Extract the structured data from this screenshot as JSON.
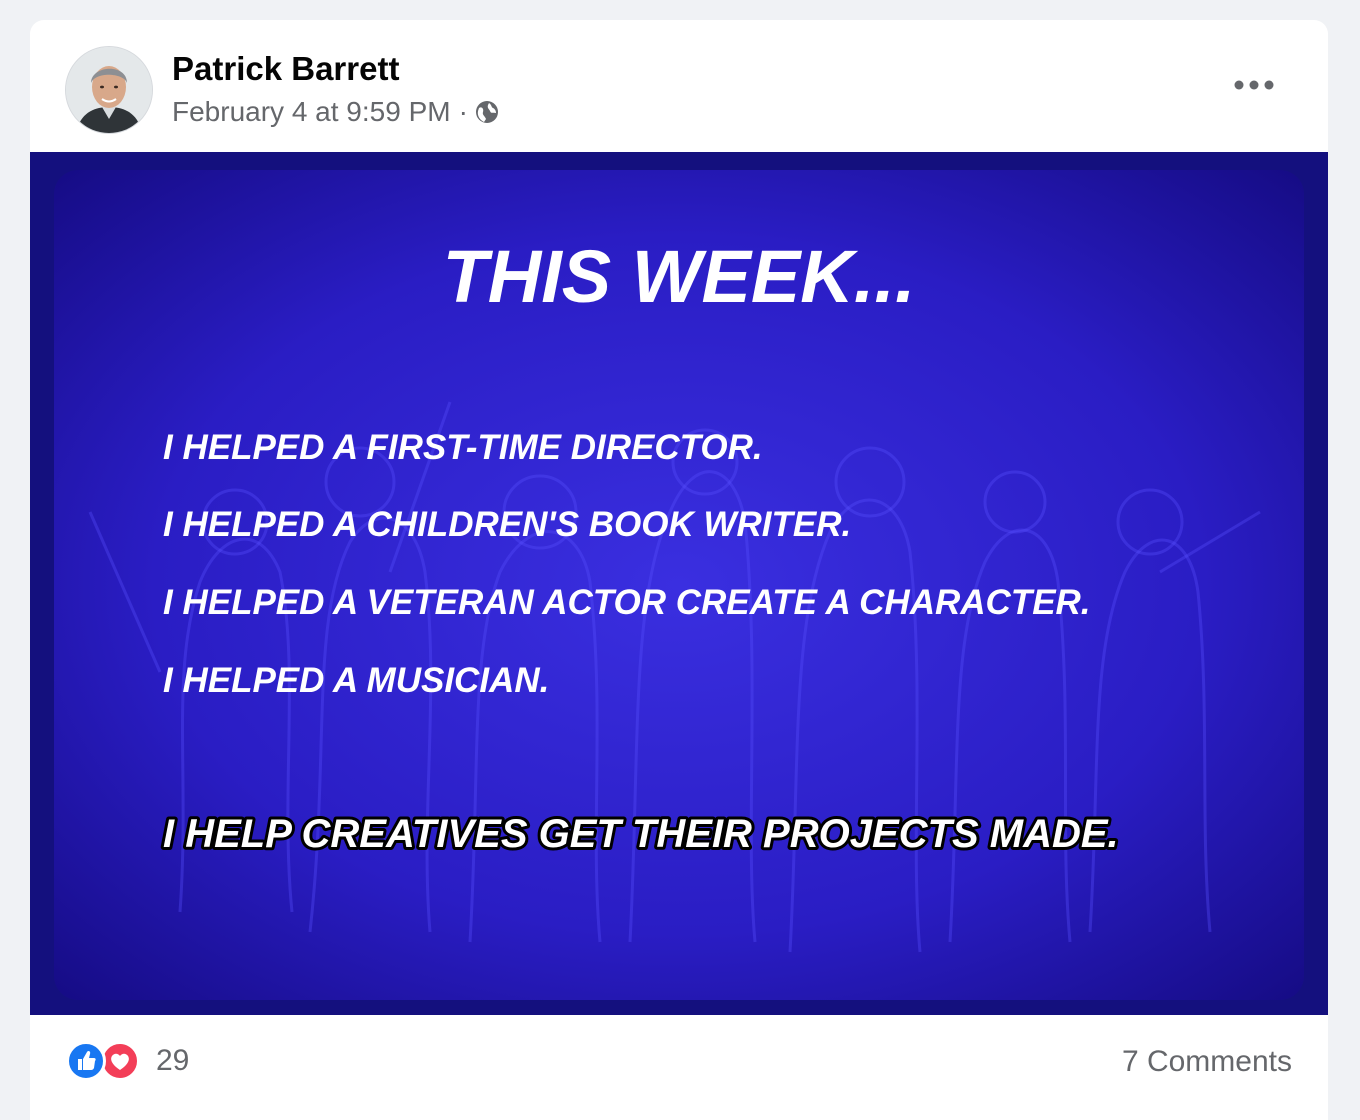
{
  "post": {
    "author": "Patrick Barrett",
    "timestamp": "February 4 at 9:59 PM",
    "separator": "·",
    "audience_icon": "globe-icon",
    "menu_icon": "more-options-icon"
  },
  "image": {
    "heading": "THIS WEEK...",
    "lines": [
      "I HELPED A FIRST-TIME DIRECTOR.",
      "I HELPED A CHILDREN'S BOOK WRITER.",
      "I HELPED A VETERAN ACTOR CREATE A CHARACTER.",
      "I HELPED A MUSICIAN."
    ],
    "tagline": "I HELP CREATIVES GET THEIR PROJECTS MADE.",
    "background_color": "#1a0fa3",
    "text_color": "#ffffff"
  },
  "footer": {
    "reactions": [
      "like-icon",
      "love-icon"
    ],
    "reaction_count": "29",
    "comments": "7 Comments"
  },
  "colors": {
    "page_bg": "#f0f2f5",
    "secondary_text": "#65676b",
    "like_blue": "#1877f2",
    "love_red": "#f33e58"
  }
}
